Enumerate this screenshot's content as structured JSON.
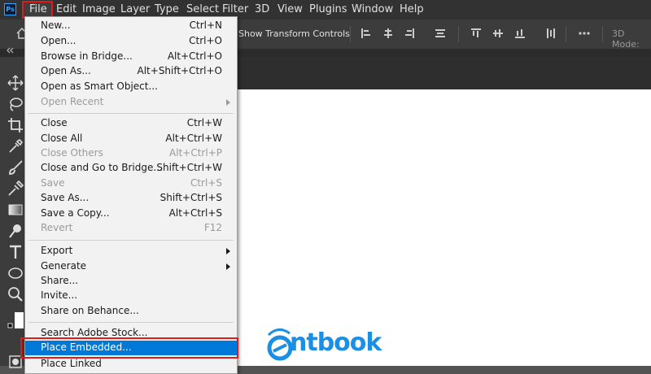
{
  "app": {
    "logo_text": "Ps"
  },
  "menubar": {
    "items": [
      "File",
      "Edit",
      "Image",
      "Layer",
      "Type",
      "Select",
      "Filter",
      "3D",
      "View",
      "Plugins",
      "Window",
      "Help"
    ]
  },
  "options_bar": {
    "show_transform_controls": "Show Transform Controls",
    "mode_label": "3D Mode:"
  },
  "file_menu": {
    "items": [
      {
        "label": "New...",
        "shortcut": "Ctrl+N"
      },
      {
        "label": "Open...",
        "shortcut": "Ctrl+O"
      },
      {
        "label": "Browse in Bridge...",
        "shortcut": "Alt+Ctrl+O"
      },
      {
        "label": "Open As...",
        "shortcut": "Alt+Shift+Ctrl+O"
      },
      {
        "label": "Open as Smart Object...",
        "shortcut": ""
      },
      {
        "label": "Open Recent",
        "shortcut": "",
        "disabled": true,
        "submenu": true
      },
      {
        "label": "Close",
        "shortcut": "Ctrl+W"
      },
      {
        "label": "Close All",
        "shortcut": "Alt+Ctrl+W"
      },
      {
        "label": "Close Others",
        "shortcut": "Alt+Ctrl+P",
        "disabled": true
      },
      {
        "label": "Close and Go to Bridge...",
        "shortcut": "Shift+Ctrl+W"
      },
      {
        "label": "Save",
        "shortcut": "Ctrl+S",
        "disabled": true
      },
      {
        "label": "Save As...",
        "shortcut": "Shift+Ctrl+S"
      },
      {
        "label": "Save a Copy...",
        "shortcut": "Alt+Ctrl+S"
      },
      {
        "label": "Revert",
        "shortcut": "F12",
        "disabled": true
      },
      {
        "label": "Export",
        "shortcut": "",
        "submenu": true
      },
      {
        "label": "Generate",
        "shortcut": "",
        "submenu": true
      },
      {
        "label": "Share...",
        "shortcut": ""
      },
      {
        "label": "Invite...",
        "shortcut": ""
      },
      {
        "label": "Share on Behance...",
        "shortcut": ""
      },
      {
        "label": "Search Adobe Stock...",
        "shortcut": ""
      },
      {
        "label": "Place Embedded...",
        "shortcut": "",
        "selected": true
      },
      {
        "label": "Place Linked",
        "shortcut": ""
      }
    ]
  },
  "watermark": {
    "text": "ntbook",
    "color": "#1a8fe3"
  },
  "colors": {
    "highlight_red": "#e01b1b",
    "selection_blue": "#0078d7"
  }
}
